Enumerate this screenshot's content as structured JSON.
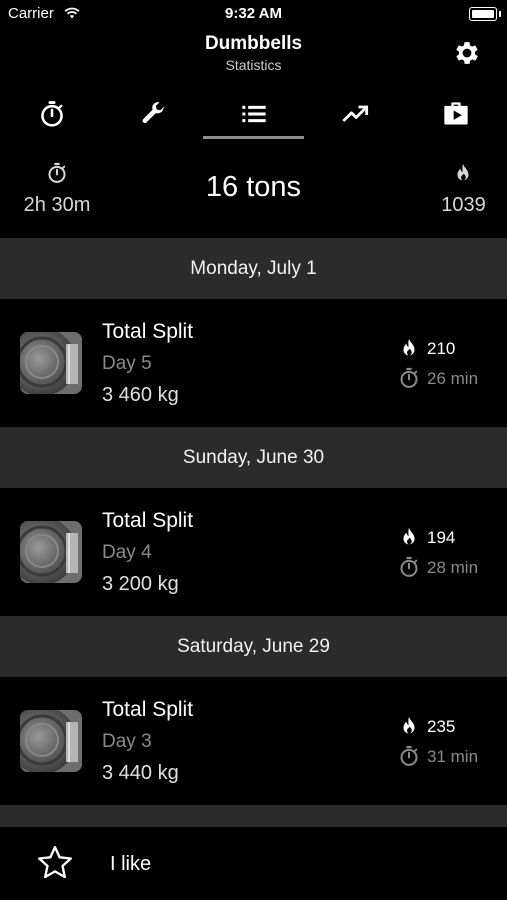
{
  "status": {
    "carrier": "Carrier",
    "time": "9:32 AM"
  },
  "header": {
    "title": "Dumbbells",
    "subtitle": "Statistics"
  },
  "tabs": [
    {
      "icon": "stopwatch-icon"
    },
    {
      "icon": "wrench-icon"
    },
    {
      "icon": "list-icon",
      "selected": true
    },
    {
      "icon": "trending-up-icon"
    },
    {
      "icon": "play-briefcase-icon"
    }
  ],
  "summary": {
    "duration": "2h 30m",
    "total": "16 tons",
    "calories": "1039"
  },
  "workouts": [
    {
      "date": "Monday, July 1",
      "name": "Total Split",
      "day": "Day 5",
      "weight": "3 460 kg",
      "calories": "210",
      "minutes": "26 min"
    },
    {
      "date": "Sunday, June 30",
      "name": "Total Split",
      "day": "Day 4",
      "weight": "3 200 kg",
      "calories": "194",
      "minutes": "28 min"
    },
    {
      "date": "Saturday, June 29",
      "name": "Total Split",
      "day": "Day 3",
      "weight": "3 440 kg",
      "calories": "235",
      "minutes": "31 min"
    }
  ],
  "footer": {
    "like_label": "I like"
  },
  "colors": {
    "background": "#000000",
    "section": "#2b2b2b",
    "muted": "#8a8a8a",
    "tab_indicator": "#8e8e8e"
  }
}
